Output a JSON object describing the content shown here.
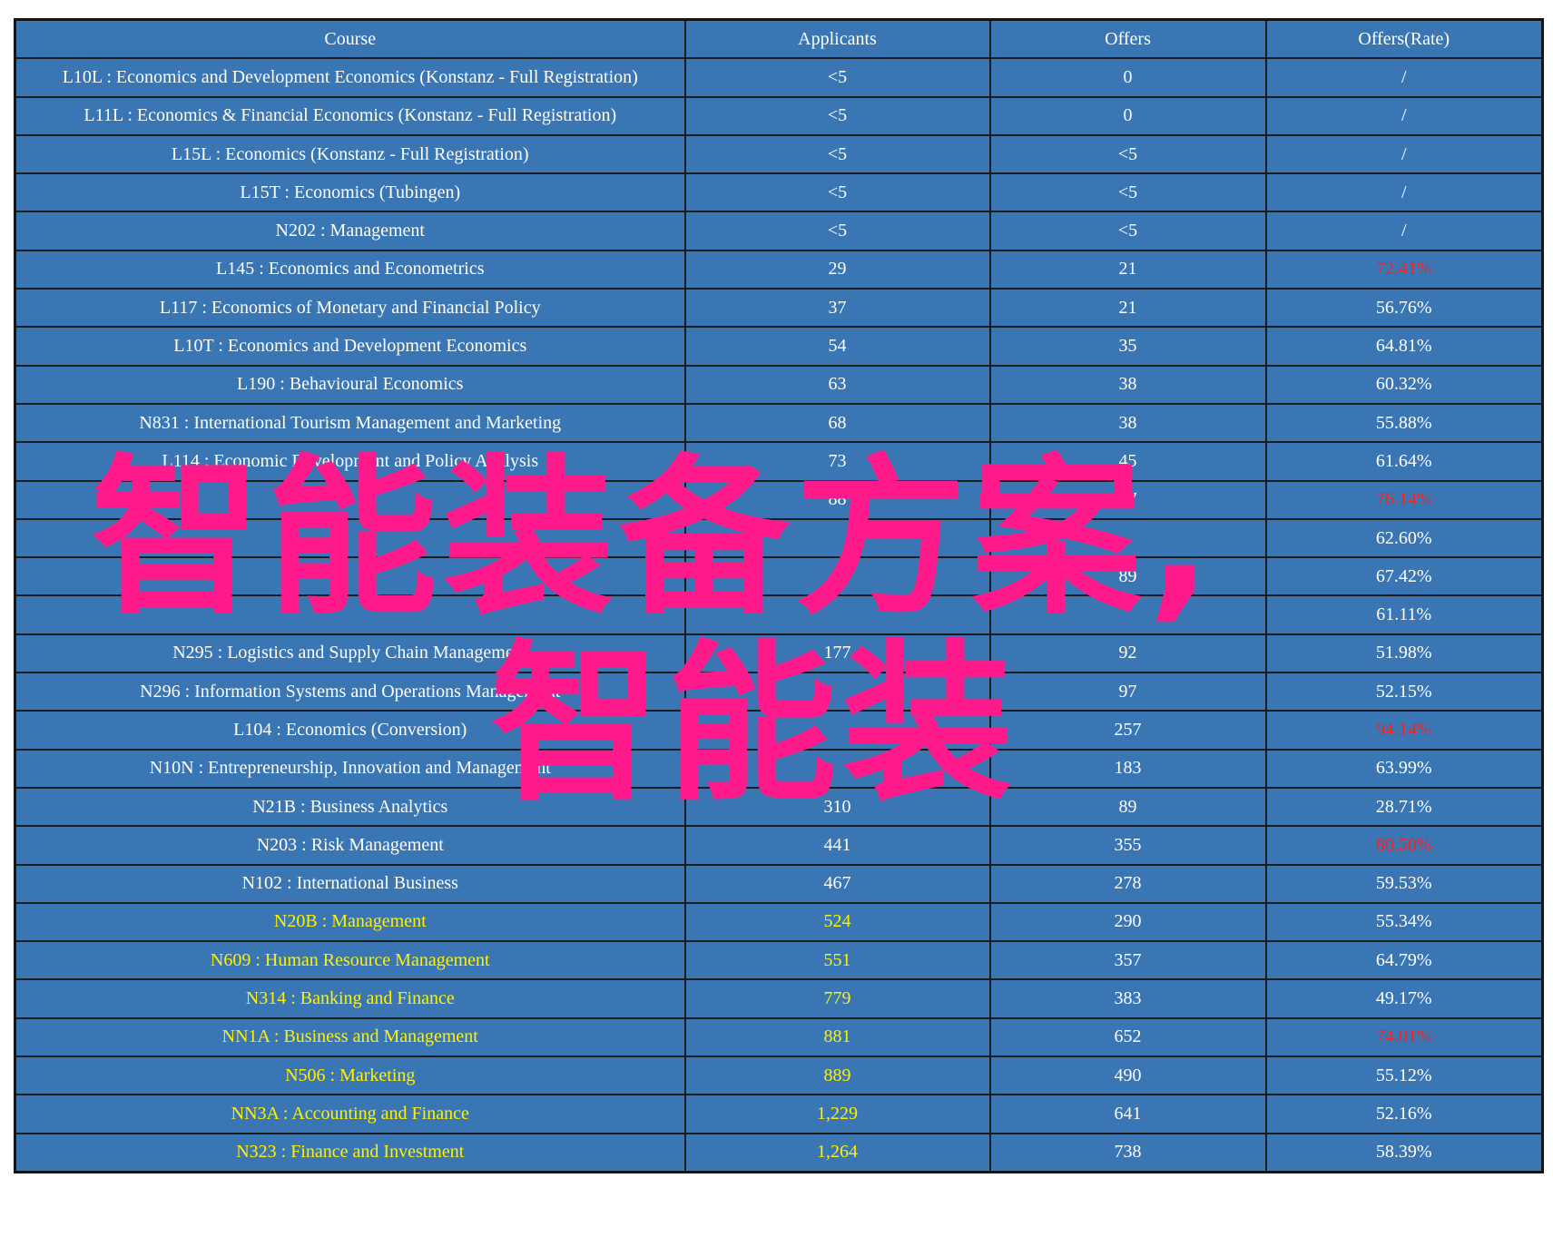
{
  "table": {
    "headers": [
      "Course",
      "Applicants",
      "Offers",
      "Offers(Rate)"
    ],
    "rows": [
      {
        "course": "L10L : Economics and Development Economics (Konstanz - Full Registration)",
        "applicants": "<5",
        "offers": "0",
        "rate": "/"
      },
      {
        "course": "L11L : Economics & Financial Economics (Konstanz - Full Registration)",
        "applicants": "<5",
        "offers": "0",
        "rate": "/"
      },
      {
        "course": "L15L : Economics (Konstanz - Full Registration)",
        "applicants": "<5",
        "offers": "<5",
        "rate": "/"
      },
      {
        "course": "L15T : Economics (Tubingen)",
        "applicants": "<5",
        "offers": "<5",
        "rate": "/"
      },
      {
        "course": "N202 : Management",
        "applicants": "<5",
        "offers": "<5",
        "rate": "/"
      },
      {
        "course": "L145 : Economics and Econometrics",
        "applicants": "29",
        "offers": "21",
        "rate": "72.41%",
        "rate_highlight": true
      },
      {
        "course": "L117 : Economics of Monetary and Financial Policy",
        "applicants": "37",
        "offers": "21",
        "rate": "56.76%"
      },
      {
        "course": "L10T : Economics and Development Economics",
        "applicants": "54",
        "offers": "35",
        "rate": "64.81%"
      },
      {
        "course": "L190 : Behavioural Economics",
        "applicants": "63",
        "offers": "38",
        "rate": "60.32%"
      },
      {
        "course": "N831 : International Tourism Management and Marketing",
        "applicants": "68",
        "offers": "38",
        "rate": "55.88%"
      },
      {
        "course": "L114 : Economic Development and Policy Analysis",
        "applicants": "73",
        "offers": "45",
        "rate": "61.64%"
      },
      {
        "course": "",
        "applicants": "88",
        "offers": "67",
        "rate": "76.14%",
        "rate_highlight": true
      },
      {
        "course": "",
        "applicants": "",
        "offers": "",
        "rate": "62.60%"
      },
      {
        "course": "",
        "applicants": "",
        "offers": "89",
        "rate": "67.42%"
      },
      {
        "course": "",
        "applicants": "",
        "offers": "",
        "rate": "61.11%"
      },
      {
        "course": "N295 : Logistics and Supply Chain Management",
        "applicants": "177",
        "offers": "92",
        "rate": "51.98%"
      },
      {
        "course": "N296 : Information Systems and Operations Management",
        "applicants": "",
        "offers": "97",
        "rate": "52.15%"
      },
      {
        "course": "L104 : Economics (Conversion)",
        "applicants": "",
        "offers": "257",
        "rate": "94.14%",
        "rate_highlight": true
      },
      {
        "course": "N10N : Entrepreneurship, Innovation and Management",
        "applicants": "",
        "offers": "183",
        "rate": "63.99%"
      },
      {
        "course": "N21B : Business Analytics",
        "applicants": "310",
        "offers": "89",
        "rate": "28.71%"
      },
      {
        "course": "N203 : Risk Management",
        "applicants": "441",
        "offers": "355",
        "rate": "80.50%",
        "rate_highlight": true
      },
      {
        "course": "N102 : International Business",
        "applicants": "467",
        "offers": "278",
        "rate": "59.53%"
      },
      {
        "course": "N20B : Management",
        "applicants": "524",
        "offers": "290",
        "rate": "55.34%",
        "course_highlight": true
      },
      {
        "course": "N609 : Human Resource Management",
        "applicants": "551",
        "offers": "357",
        "rate": "64.79%",
        "course_highlight": true
      },
      {
        "course": "N314 : Banking and Finance",
        "applicants": "779",
        "offers": "383",
        "rate": "49.17%",
        "course_highlight": true
      },
      {
        "course": "NN1A : Business and Management",
        "applicants": "881",
        "offers": "652",
        "rate": "74.01%",
        "rate_highlight": true,
        "course_highlight": true
      },
      {
        "course": "N506 : Marketing",
        "applicants": "889",
        "offers": "490",
        "rate": "55.12%",
        "course_highlight": true
      },
      {
        "course": "NN3A : Accounting and Finance",
        "applicants": "1,229",
        "offers": "641",
        "rate": "52.16%",
        "course_highlight": true
      },
      {
        "course": "N323 : Finance and Investment",
        "applicants": "1,264",
        "offers": "738",
        "rate": "58.39%",
        "course_highlight": true
      }
    ]
  },
  "overlay": {
    "line1": "智能装备方案,",
    "line2": "智能装",
    "color": "#ff1a8c"
  },
  "colors": {
    "cell_bg": "#3a76b4",
    "text": "#ffffff",
    "highlight_yellow": "#fff200",
    "highlight_red": "#ff1f1f"
  }
}
